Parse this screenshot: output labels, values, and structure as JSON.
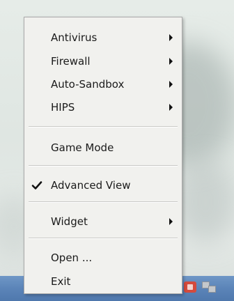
{
  "menu": {
    "items": [
      {
        "label": "Antivirus",
        "submenu": true
      },
      {
        "label": "Firewall",
        "submenu": true
      },
      {
        "label": "Auto-Sandbox",
        "submenu": true
      },
      {
        "label": "HIPS",
        "submenu": true
      },
      {
        "label": "Game Mode",
        "submenu": false
      },
      {
        "label": "Advanced View",
        "submenu": false,
        "checked": true
      },
      {
        "label": "Widget",
        "submenu": true
      },
      {
        "label": "Open ...",
        "submenu": false
      },
      {
        "label": "Exit",
        "submenu": false
      }
    ]
  },
  "colors": {
    "menu_background": "#f1f1ee",
    "menu_border": "#a9a9a9",
    "taskbar": "#5b84b8",
    "tray_shield": "#d44a3d"
  },
  "icons": {
    "check": "check-icon",
    "submenu": "submenu-arrow-icon",
    "tray_security": "shield-icon",
    "tray_network": "network-icon"
  }
}
